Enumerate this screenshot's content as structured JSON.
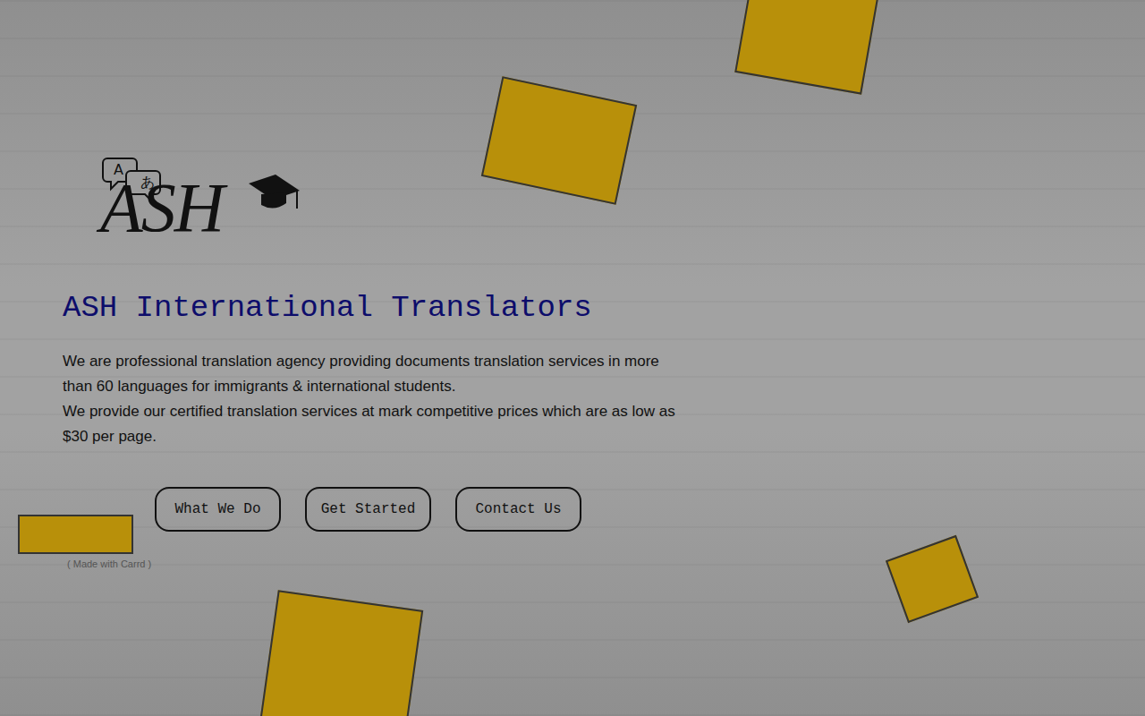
{
  "logo": {
    "bubbles": [
      "A",
      "あ"
    ],
    "text": "ASH"
  },
  "title": "ASH International Translators",
  "description": [
    "We are professional translation agency providing documents translation services in more than 60 languages for immigrants & international students.",
    "We provide our certified translation services at mark competitive prices which are as low as $30 per page."
  ],
  "buttons": [
    "What We Do",
    "Get Started",
    "Contact Us"
  ],
  "footer": "( Made with Carrd )"
}
